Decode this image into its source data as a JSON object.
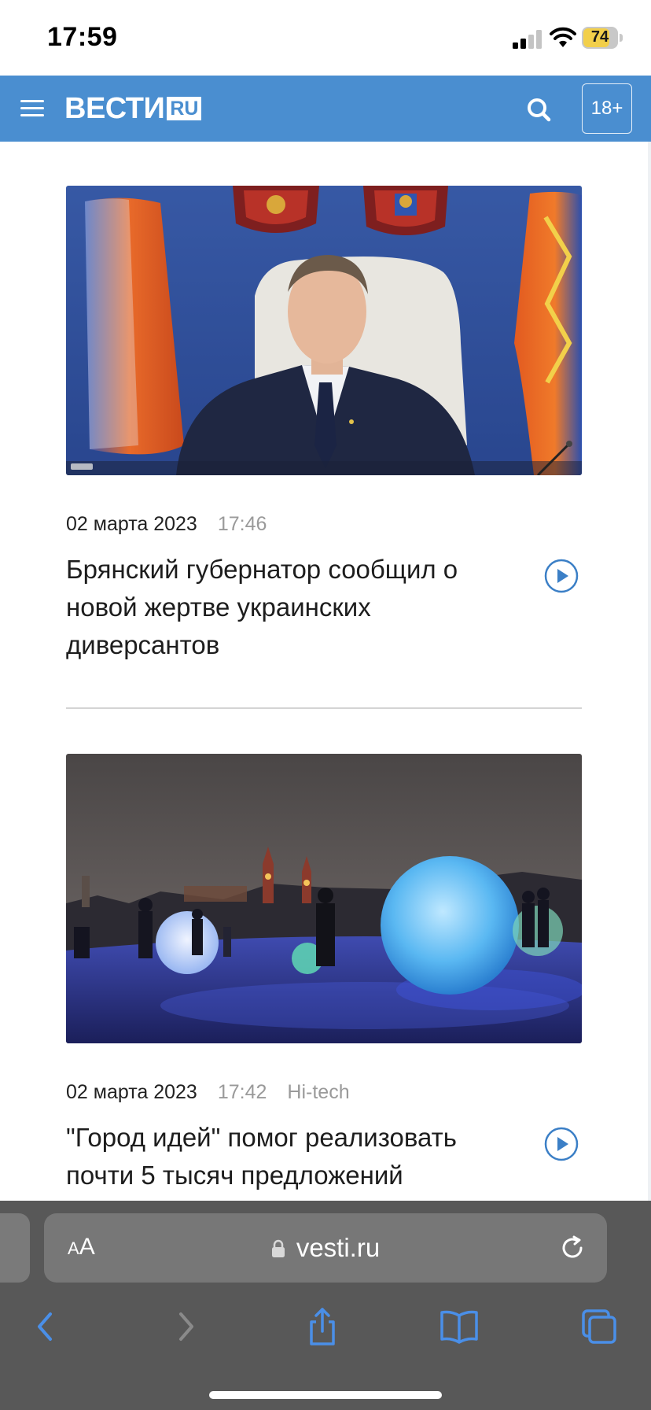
{
  "status_bar": {
    "time": "17:59",
    "battery": "74"
  },
  "header": {
    "logo_main": "ВЕСТИ",
    "logo_suffix": "RU",
    "age_rating": "18+",
    "brand_color": "#4a8ed0"
  },
  "articles": [
    {
      "date": "02 марта 2023",
      "time": "17:46",
      "rubric": "",
      "title": "Брянский губернатор сообщил о новой жертве украинских диверсантов",
      "has_video": true
    },
    {
      "date": "02 марта 2023",
      "time": "17:42",
      "rubric": "Hi-tech",
      "title": "\"Город идей\" помог реализовать почти 5 тысяч предложений",
      "has_video": true
    }
  ],
  "browser": {
    "text_size_label_small": "A",
    "text_size_label_large": "A",
    "url": "vesti.ru",
    "toolbar_icons": [
      "back-icon",
      "forward-icon",
      "share-icon",
      "bookmarks-icon",
      "tabs-icon"
    ]
  }
}
